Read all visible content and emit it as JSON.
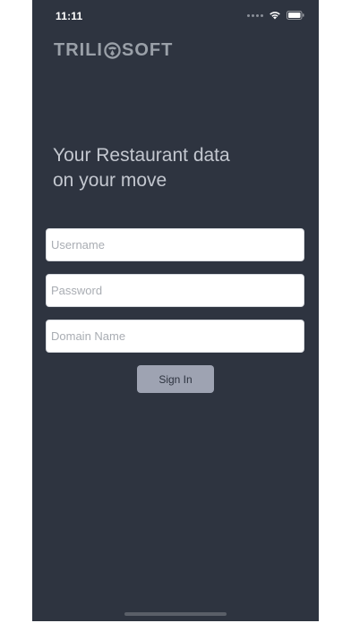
{
  "status_bar": {
    "time": "11:11"
  },
  "logo": {
    "text_left": "TRILI",
    "text_right": "SOFT"
  },
  "tagline": {
    "line1": "Your Restaurant data",
    "line2": "on your move"
  },
  "form": {
    "username_placeholder": "Username",
    "password_placeholder": "Password",
    "domain_placeholder": "Domain Name",
    "signin_label": "Sign In"
  },
  "colors": {
    "background": "#2e3440",
    "button": "#9ea3b2",
    "logo": "#9aa0a8"
  },
  "icons": [
    "wifi-icon",
    "battery-icon",
    "logo-mark-icon"
  ]
}
